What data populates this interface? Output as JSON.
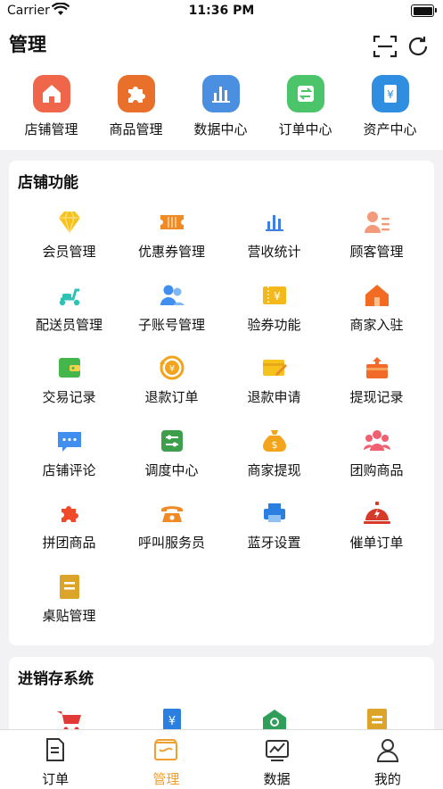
{
  "status_bar": {
    "carrier": "Carrier",
    "time": "11:36 PM"
  },
  "header": {
    "title": "管理"
  },
  "quick_actions": [
    {
      "label": "店铺管理",
      "icon": "store-icon",
      "color": "#f0664a"
    },
    {
      "label": "商品管理",
      "icon": "puzzle-icon",
      "color": "#e8702a"
    },
    {
      "label": "数据中心",
      "icon": "bar-chart-icon",
      "color": "#4a8fe0"
    },
    {
      "label": "订单中心",
      "icon": "transfer-icon",
      "color": "#4cc46a"
    },
    {
      "label": "资产中心",
      "icon": "yen-icon",
      "color": "#2f8ee0"
    }
  ],
  "store_functions": {
    "title": "店铺功能",
    "items": [
      {
        "label": "会员管理",
        "icon": "diamond-icon"
      },
      {
        "label": "优惠券管理",
        "icon": "ticket-icon"
      },
      {
        "label": "营收统计",
        "icon": "bar-chart-icon"
      },
      {
        "label": "顾客管理",
        "icon": "customer-icon"
      },
      {
        "label": "配送员管理",
        "icon": "scooter-icon"
      },
      {
        "label": "子账号管理",
        "icon": "users-icon"
      },
      {
        "label": "验券功能",
        "icon": "coupon-check-icon"
      },
      {
        "label": "商家入驻",
        "icon": "house-icon"
      },
      {
        "label": "交易记录",
        "icon": "wallet-icon"
      },
      {
        "label": "退款订单",
        "icon": "refund-coin-icon"
      },
      {
        "label": "退款申请",
        "icon": "card-edit-icon"
      },
      {
        "label": "提现记录",
        "icon": "withdraw-box-icon"
      },
      {
        "label": "店铺评论",
        "icon": "chat-bubble-icon"
      },
      {
        "label": "调度中心",
        "icon": "dispatch-icon"
      },
      {
        "label": "商家提现",
        "icon": "money-bag-icon"
      },
      {
        "label": "团购商品",
        "icon": "group-icon"
      },
      {
        "label": "拼团商品",
        "icon": "puzzle-icon"
      },
      {
        "label": "呼叫服务员",
        "icon": "phone-icon"
      },
      {
        "label": "蓝牙设置",
        "icon": "printer-icon"
      },
      {
        "label": "催单订单",
        "icon": "bell-icon"
      },
      {
        "label": "桌贴管理",
        "icon": "sticker-icon"
      }
    ]
  },
  "inventory": {
    "title": "进销存系统",
    "items": [
      {
        "icon": "cart-icon"
      },
      {
        "icon": "invoice-icon"
      },
      {
        "icon": "warehouse-search-icon"
      },
      {
        "icon": "document-icon"
      }
    ]
  },
  "tabbar": [
    {
      "label": "订单",
      "icon": "order-doc-icon",
      "active": false
    },
    {
      "label": "管理",
      "icon": "manage-icon",
      "active": true
    },
    {
      "label": "数据",
      "icon": "chart-icon",
      "active": false
    },
    {
      "label": "我的",
      "icon": "user-icon",
      "active": false
    }
  ],
  "colors": {
    "accent": "#f0a030",
    "text": "#111111",
    "background": "#f2f2f4"
  }
}
